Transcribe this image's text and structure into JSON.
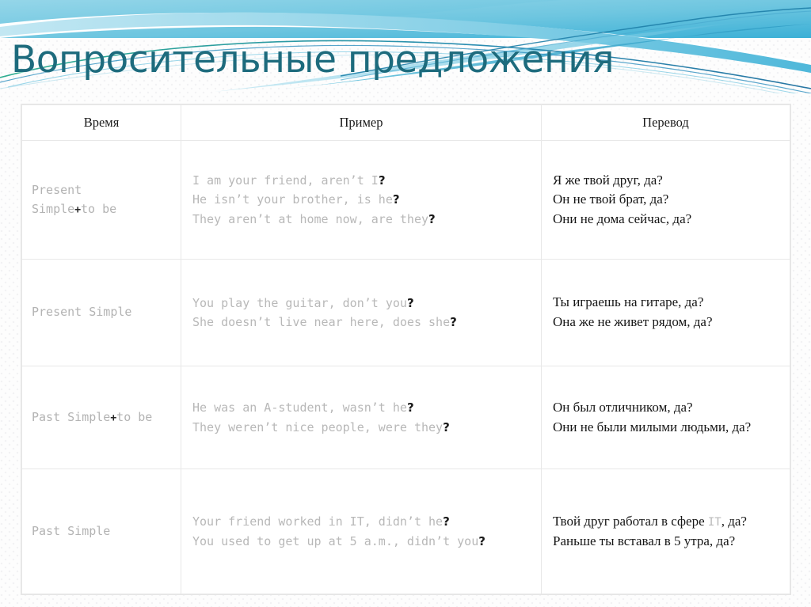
{
  "page": {
    "title": "Вопросительные предложения",
    "title_color": "#1d6b7d",
    "background_color": "#fdfdfd"
  },
  "header_band": {
    "name": "decorative-wave-banner",
    "colors": {
      "sky": "#8ed3e8",
      "mid": "#63c2dd",
      "deep": "#2e9fc6",
      "teal_line": "#1f7fa8",
      "green_line": "#26a884",
      "white": "#ffffff"
    }
  },
  "table": {
    "columns": [
      {
        "key": "time",
        "label": "Время"
      },
      {
        "key": "example",
        "label": "Пример"
      },
      {
        "key": "translation",
        "label": "Перевод"
      }
    ],
    "rows": [
      {
        "tense_prefix": "Present\nSimple",
        "tense_plus": "+",
        "tense_suffix": "to be",
        "examples": [
          {
            "text": "I am your friend, aren’t I",
            "mark": "?"
          },
          {
            "text": "He isn’t your brother, is he",
            "mark": "?"
          },
          {
            "text": "They aren’t at home now, are they",
            "mark": "?"
          }
        ],
        "translations": [
          "Я же твой друг, да?",
          "Он не твой брат, да?",
          "Они не дома сейчас, да?"
        ]
      },
      {
        "tense_prefix": "Present Simple",
        "tense_plus": "",
        "tense_suffix": "",
        "examples": [
          {
            "text": "You play the guitar, don’t you",
            "mark": "?"
          },
          {
            "text": "She doesn’t live near here, does she",
            "mark": "?"
          }
        ],
        "translations": [
          "Ты играешь на гитаре, да?",
          "Она же не живет рядом, да?"
        ]
      },
      {
        "tense_prefix": "Past Simple",
        "tense_plus": "+",
        "tense_suffix": "to be",
        "examples": [
          {
            "text": "He was an A-student, wasn’t he",
            "mark": "?"
          },
          {
            "text": "They weren’t nice people, were they",
            "mark": "?"
          }
        ],
        "translations": [
          "Он был отличником, да?",
          "Они не были милыми людьми, да?"
        ]
      },
      {
        "tense_prefix": "Past Simple",
        "tense_plus": "",
        "tense_suffix": "",
        "examples": [
          {
            "text": "Your friend worked in IT, didn’t he",
            "mark": "?"
          },
          {
            "text": "You used to get up at 5 a.m., didn’t you",
            "mark": "?"
          }
        ],
        "translations": [
          "Твой друг работал в сфере IT, да?",
          "Раньше ты вставал в 5 утра, да?"
        ],
        "translation_mono_token": "IT"
      }
    ]
  }
}
